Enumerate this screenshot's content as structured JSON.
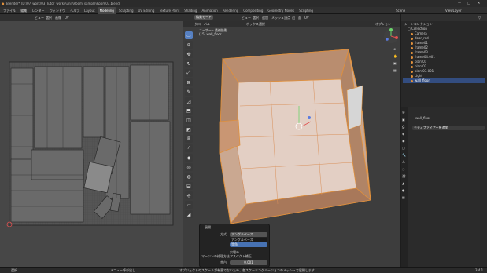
{
  "window": {
    "title": "Blender* [D:\\07_work\\03_Tutor_works\\unit\\Room_sample\\Room03.blend]"
  },
  "menu": {
    "items": [
      "ファイル",
      "編集",
      "レンダー",
      "ウィンドウ",
      "ヘルプ"
    ],
    "workspace_tabs": [
      "Layout",
      "Modeling",
      "Sculpting",
      "UV Editing",
      "Texture Paint",
      "Shading",
      "Animation",
      "Rendering",
      "Compositing",
      "Geometry Nodes",
      "Scripting"
    ],
    "active_tab": "Modeling",
    "scene": "Scene",
    "view_layer": "ViewLayer"
  },
  "uv_editor": {
    "header_labels": [
      "ビュー",
      "選択",
      "画像",
      "UV"
    ]
  },
  "viewport": {
    "mode": "編集モード",
    "header_labels": [
      "ビュー",
      "選択",
      "追加",
      "メッシュ",
      "頂点",
      "辺",
      "面",
      "UV"
    ],
    "transform_orientation": "グローバル",
    "pivot": "ボックス選択",
    "options": "オプション",
    "overlay_view": "ユーザー・透視投影",
    "overlay_object": "(15) wall_floor"
  },
  "outliner": {
    "title": "シーンコレクション",
    "items": [
      {
        "label": "Collection",
        "selected": false
      },
      {
        "label": "Camera",
        "selected": false
      },
      {
        "label": "door_red",
        "selected": false
      },
      {
        "label": "frame01",
        "selected": false
      },
      {
        "label": "frame02",
        "selected": false
      },
      {
        "label": "frame03",
        "selected": false
      },
      {
        "label": "frame04.001",
        "selected": false
      },
      {
        "label": "plant01",
        "selected": false
      },
      {
        "label": "plant02",
        "selected": false
      },
      {
        "label": "plant03.001",
        "selected": false
      },
      {
        "label": "Light",
        "selected": false
      },
      {
        "label": "wall_floor",
        "selected": true
      }
    ]
  },
  "properties": {
    "object_name": "wall_floor",
    "add_modifier": "モディファイアーを追加"
  },
  "redo_panel": {
    "title": "展開",
    "method_label": "方式",
    "method_value": "アングルベース",
    "options": [
      "アングルベース",
      "等角"
    ],
    "selected_option": "等角",
    "fill_label": "穴埋め",
    "correct_label": "アスペクト補正",
    "margin_method_label": "マージンの処理方法",
    "margin_label": "余白",
    "margin_value": "0.001"
  },
  "statusbar": {
    "left": "選択",
    "middle": "メニュー呼び出し",
    "center": "オブジェクトのスケールが有意でないため、各スケーリングバージョンのメッシュで展開します",
    "version": "3.4.1"
  },
  "colors": {
    "accent": "#e0903c",
    "selection": "#334d80",
    "active_blue": "#4772b3"
  }
}
